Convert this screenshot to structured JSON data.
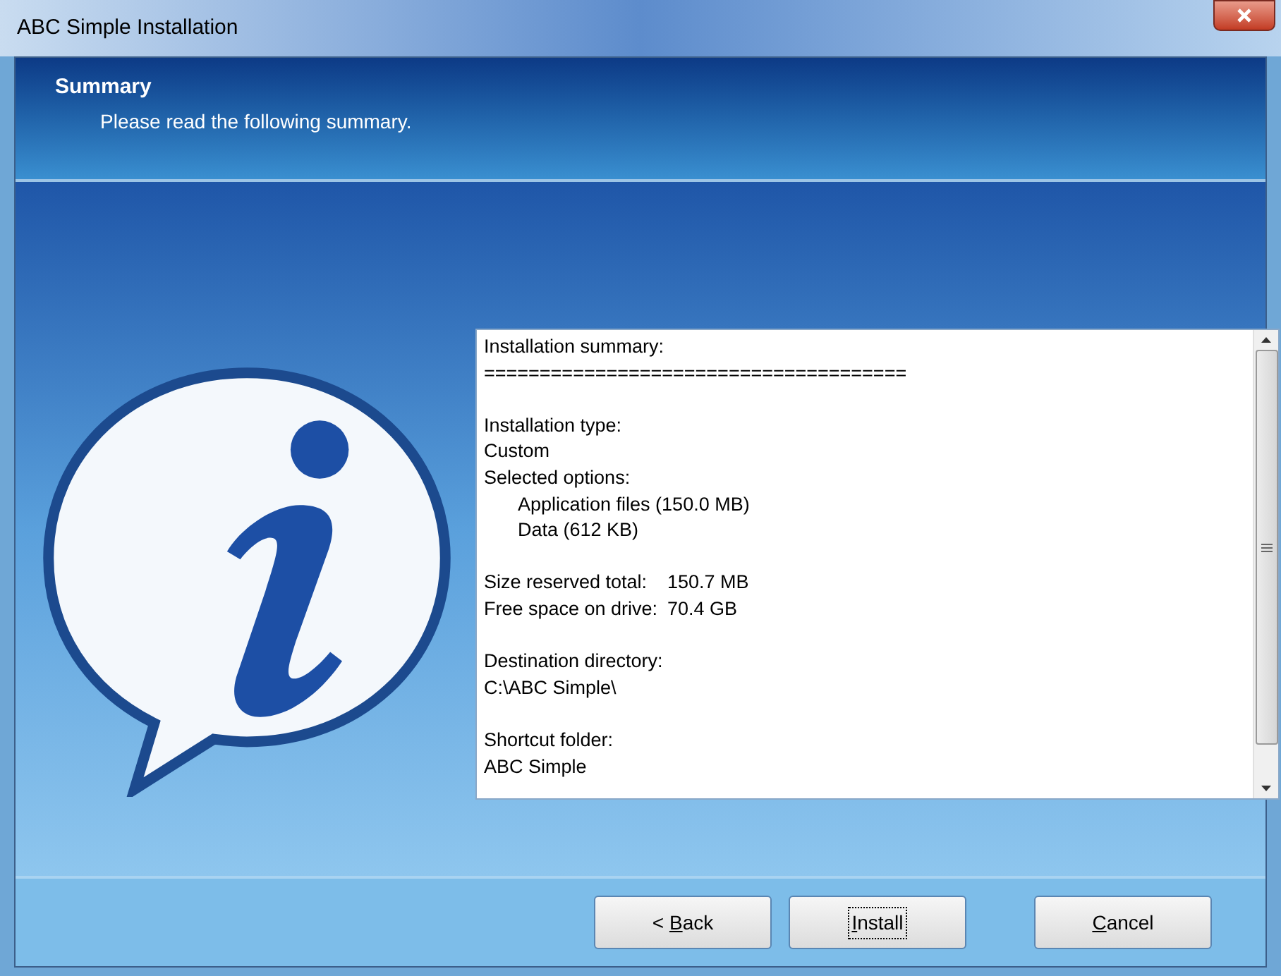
{
  "window": {
    "title": "ABC Simple Installation"
  },
  "header": {
    "title": "Summary",
    "subtitle": "Please read the following summary."
  },
  "summary": {
    "sections": [
      [
        {
          "kind": "text",
          "text": "Installation summary:"
        },
        {
          "kind": "text",
          "text": "======================================"
        }
      ],
      [
        {
          "kind": "text",
          "text": "Installation type:"
        },
        {
          "kind": "text",
          "text": "Custom"
        },
        {
          "kind": "text",
          "text": "Selected options:",
          "children": [
            {
              "kind": "text",
              "text": "Application files (150.0 MB)"
            },
            {
              "kind": "text",
              "text": "Data (612 KB)"
            }
          ]
        }
      ],
      [
        {
          "kind": "pair",
          "label": "Size reserved total:",
          "value": "150.7 MB"
        },
        {
          "kind": "pair",
          "label": "Free space on drive:",
          "value": "70.4 GB"
        }
      ],
      [
        {
          "kind": "text",
          "text": "Destination directory:"
        },
        {
          "kind": "text",
          "text": "C:\\ABC Simple\\"
        }
      ],
      [
        {
          "kind": "text",
          "text": "Shortcut folder:"
        },
        {
          "kind": "text",
          "text": "ABC Simple"
        }
      ]
    ]
  },
  "buttons": [
    {
      "before": "< ",
      "key": "B",
      "after": "ack",
      "focused": false
    },
    {
      "key": "I",
      "after": "nstall",
      "focused": true
    },
    {
      "key": "C",
      "after": "ancel",
      "focused": false
    }
  ]
}
